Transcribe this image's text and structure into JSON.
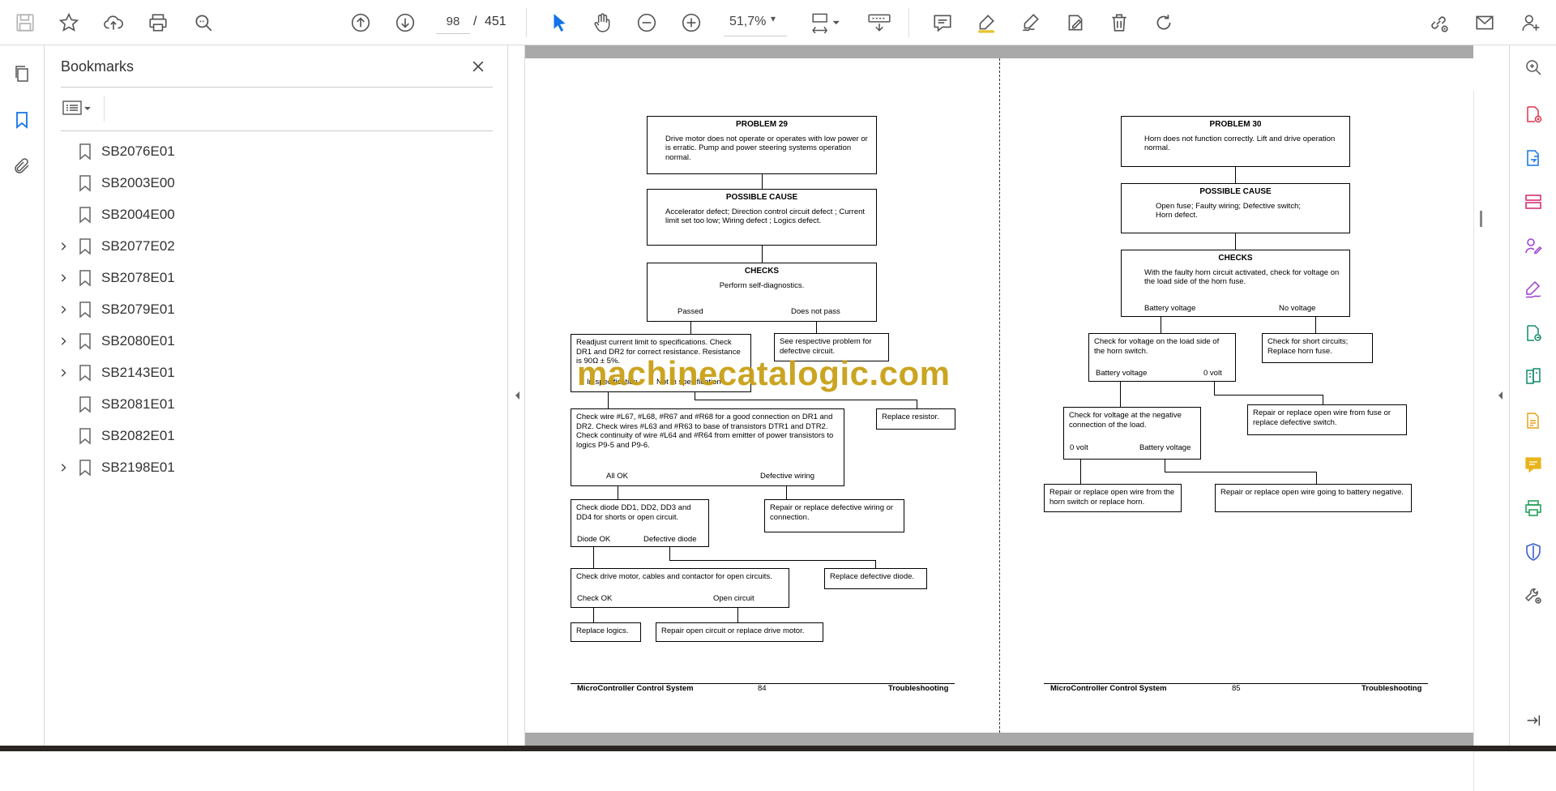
{
  "toolbar": {
    "page_current": "98",
    "page_separator": "/",
    "page_total": "451",
    "zoom": "51,7%",
    "zoom_caret": "▾"
  },
  "bookmarks": {
    "title": "Bookmarks",
    "items": [
      {
        "label": "SB2076E01",
        "expandable": false
      },
      {
        "label": "SB2003E00",
        "expandable": false
      },
      {
        "label": "SB2004E00",
        "expandable": false
      },
      {
        "label": "SB2077E02",
        "expandable": true
      },
      {
        "label": "SB2078E01",
        "expandable": true
      },
      {
        "label": "SB2079E01",
        "expandable": true
      },
      {
        "label": "SB2080E01",
        "expandable": true
      },
      {
        "label": "SB2143E01",
        "expandable": true
      },
      {
        "label": "SB2081E01",
        "expandable": false
      },
      {
        "label": "SB2082E01",
        "expandable": false
      },
      {
        "label": "SB2198E01",
        "expandable": true
      }
    ]
  },
  "watermark": "machinecatalogic.com",
  "page_left": {
    "problem_title": "PROBLEM 29",
    "problem_text": "Drive motor does not operate or operates with low power or is erratic. Pump and power steering systems operation normal.",
    "cause_title": "POSSIBLE CAUSE",
    "cause_text": "Accelerator defect; Direction control circuit defect ; Current limit set too low; Wiring defect ; Logics defect.",
    "checks_title": "CHECKS",
    "checks_text": "Perform self-diagnostics.",
    "passed": "Passed",
    "not_pass": "Does not pass",
    "readjust": "Readjust current limit to specifications. Check DR1 and DR2 for correct resistance. Resistance is 90Ω ± 5%.",
    "in_spec": "In specification",
    "not_in_spec": "Not in specification",
    "see_problem": "See respective problem for defective circuit.",
    "replace_resistor": "Replace resistor.",
    "check_wire": "Check wire #L67, #L68, #R67 and #R68 for a good connection on DR1 and DR2. Check wires #L63 and #R63 to base of transistors DTR1 and DTR2. Check continuity of wire #L64 and #R64 from emitter of power transistors to logics P9-5 and P9-6.",
    "all_ok": "All OK",
    "defective_wiring": "Defective wiring",
    "repair_wiring": "Repair or replace defective wiring or connection.",
    "check_diode": "Check diode DD1, DD2, DD3 and DD4 for shorts or open circuit.",
    "diode_ok": "Diode OK",
    "defective_diode": "Defective diode",
    "replace_diode": "Replace defective diode.",
    "check_motor": "Check drive motor, cables and contactor for open circuits.",
    "check_ok": "Check OK",
    "open_circuit": "Open circuit",
    "replace_logics": "Replace logics.",
    "repair_motor": "Repair open circuit or replace drive motor.",
    "footer_left": "MicroController Control System",
    "footer_page": "84",
    "footer_right": "Troubleshooting"
  },
  "page_right": {
    "problem_title": "PROBLEM 30",
    "problem_text": "Horn does not function correctly. Lift and drive operation normal.",
    "cause_title": "POSSIBLE CAUSE",
    "cause_text": "Open fuse; Faulty wiring; Defective switch; Horn defect.",
    "checks_title": "CHECKS",
    "checks_text": "With the faulty horn circuit activated, check for voltage on the load side of the horn fuse.",
    "battery_voltage": "Battery voltage",
    "no_voltage": "No voltage",
    "check_load_side": "Check for voltage on the load side of the horn switch.",
    "bv2": "Battery voltage",
    "zero_volt": "0 volt",
    "check_short": "Check for short circuits; Replace horn fuse.",
    "check_negative": "Check for voltage at the negative connection of the load.",
    "zero_volt2": "0 volt",
    "bv3": "Battery voltage",
    "repair_fuse": "Repair or replace open wire from fuse or replace defective switch.",
    "repair_switch": "Repair or replace open wire from the horn switch or replace horn.",
    "repair_battery": "Repair or replace open wire going to battery negative.",
    "footer_left": "MicroController Control System",
    "footer_page": "85",
    "footer_right": "Troubleshooting"
  },
  "colors": {
    "accent_blue": "#1473e6",
    "icon_gray": "#5c5c5c",
    "watermark": "#c9a016"
  }
}
